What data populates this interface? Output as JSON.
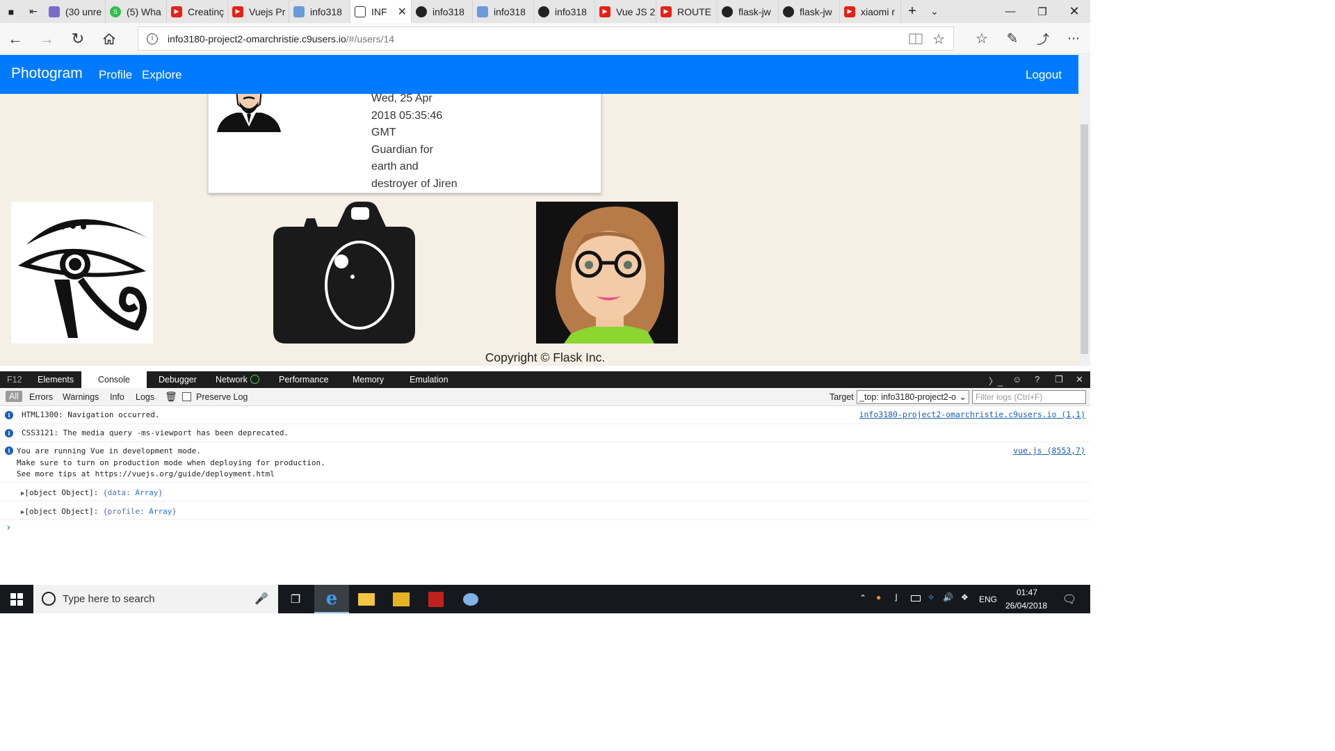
{
  "browser": {
    "tabs": [
      {
        "label": "(30 unre",
        "icon": "mail-icon"
      },
      {
        "label": "(5) Wha",
        "icon": "whatsapp-icon"
      },
      {
        "label": "Creatinç",
        "icon": "youtube-icon"
      },
      {
        "label": "Vuejs Pr",
        "icon": "youtube-icon"
      },
      {
        "label": "info318",
        "icon": "cloud9-icon"
      },
      {
        "label": "INF",
        "icon": "page-icon",
        "active": true
      },
      {
        "label": "info318",
        "icon": "github-icon"
      },
      {
        "label": "info318",
        "icon": "cloud9-icon"
      },
      {
        "label": "info318",
        "icon": "github-icon"
      },
      {
        "label": "Vue JS 2",
        "icon": "youtube-icon"
      },
      {
        "label": "ROUTE",
        "icon": "youtube-icon"
      },
      {
        "label": "flask-jw",
        "icon": "github-icon"
      },
      {
        "label": "flask-jw",
        "icon": "github-icon"
      },
      {
        "label": "xiaomi r",
        "icon": "youtube-icon"
      }
    ],
    "url_host": "info3180-project2-omarchristie.c9users.io",
    "url_path": "/#/users/14"
  },
  "app": {
    "brand": "Photogram",
    "nav": {
      "profile": "Profile",
      "explore": "Explore",
      "logout": "Logout"
    },
    "profile": {
      "date_lines": [
        "Wed, 25 Apr",
        "2018 05:35:46",
        "GMT"
      ],
      "bio_lines": [
        "Guardian for",
        "earth and",
        "destroyer of Jiren"
      ]
    },
    "footer": "Copyright © Flask Inc."
  },
  "devtools": {
    "tabs": {
      "f12": "F12",
      "elements": "Elements",
      "console": "Console",
      "debugger": "Debugger",
      "network": "Network",
      "performance": "Performance",
      "memory": "Memory",
      "emulation": "Emulation"
    },
    "filters": {
      "all": "All",
      "errors": "Errors",
      "warnings": "Warnings",
      "info": "Info",
      "logs": "Logs",
      "preserve_log": "Preserve Log"
    },
    "target_label": "Target",
    "target_value": "_top: info3180-project2-o",
    "filter_placeholder": "Filter logs (Ctrl+F)",
    "logs": [
      {
        "text": "HTML1300: Navigation occurred.",
        "source": "info3180-project2-omarchristie.c9users.io (1,1)"
      },
      {
        "text": "CSS3121: The media query -ms-viewport has been deprecated."
      },
      {
        "text": "You are running Vue in development mode.\nMake sure to turn on production mode when deploying for production.\nSee more tips at https://vuejs.org/guide/deployment.html",
        "source": "vue.js (8553,7)"
      }
    ],
    "objects": [
      {
        "prefix": "[object Object]:",
        "open": "{data:",
        "type": "Array",
        "close": "}"
      },
      {
        "prefix": "[object Object]:",
        "open": "{profile:",
        "type": "Array",
        "close": "}"
      }
    ],
    "prompt": "›"
  },
  "taskbar": {
    "search_placeholder": "Type here to search",
    "lang": "ENG",
    "time": "01:47",
    "date": "26/04/2018"
  }
}
